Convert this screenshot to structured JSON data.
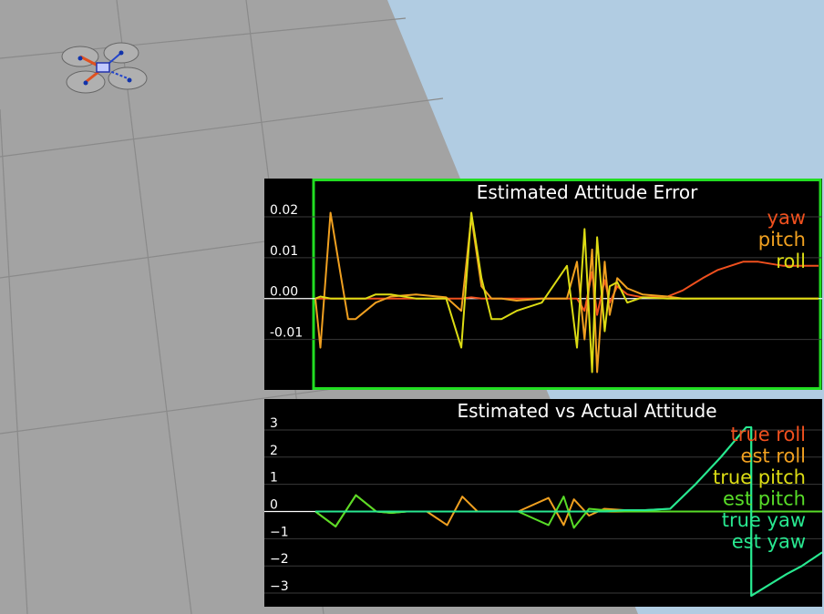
{
  "colors": {
    "sky": "#b1cce2",
    "ground": "#a3a3a3",
    "grid_line": "#8a8a8a",
    "panel_bg": "#000000",
    "active_border": "#22dd22",
    "zero_line": "#ffffff",
    "red": "#f0501e",
    "orange": "#f0a020",
    "yellow": "#dcdc14",
    "green": "#58dc28",
    "teal": "#28e890"
  },
  "quad": {
    "icon": "quadrotor-icon"
  },
  "charts": [
    {
      "title": "Estimated Attitude Error",
      "y_ticks": [
        "0.02",
        "0.01",
        "0.00",
        "-0.01"
      ],
      "y_tick_values": [
        0.02,
        0.01,
        0.0,
        -0.01
      ],
      "ylim": [
        -0.021,
        0.024
      ],
      "xlim": [
        0,
        10
      ],
      "legend": [
        {
          "label": "yaw",
          "color": "#f0501e"
        },
        {
          "label": "pitch",
          "color": "#f0a020"
        },
        {
          "label": "roll",
          "color": "#dcdc14"
        }
      ],
      "chart_data": {
        "type": "line",
        "x": [
          0,
          0.1,
          0.3,
          0.5,
          0.65,
          0.8,
          1.0,
          1.2,
          1.5,
          2.0,
          2.6,
          2.9,
          3.1,
          3.3,
          3.5,
          3.7,
          4.0,
          4.5,
          5.0,
          5.2,
          5.35,
          5.5,
          5.6,
          5.75,
          5.85,
          6.0,
          6.2,
          6.5,
          7.0,
          7.3,
          7.7,
          8.0,
          8.5,
          8.8,
          9.3,
          10
        ],
        "series": [
          {
            "name": "yaw",
            "values": [
              0,
              0,
              0,
              0,
              0,
              0,
              0,
              0,
              0,
              0,
              0,
              0,
              0.0003,
              0,
              0,
              0,
              0,
              0,
              0,
              0,
              -0.003,
              0.0065,
              -0.004,
              0.0045,
              -0.001,
              0.003,
              0.001,
              0.0003,
              0.0005,
              0.002,
              0.005,
              0.007,
              0.009,
              0.009,
              0.008,
              0.008
            ]
          },
          {
            "name": "pitch",
            "values": [
              0,
              -0.012,
              0.021,
              0.006,
              -0.005,
              -0.005,
              -0.003,
              -0.001,
              0.0005,
              0.001,
              0.0003,
              -0.003,
              0.02,
              0.003,
              0,
              0,
              -0.0005,
              0,
              0,
              0.009,
              -0.01,
              0.012,
              -0.018,
              0.009,
              -0.004,
              0.005,
              0.0025,
              0.001,
              0.0005,
              0,
              0,
              0,
              0,
              0,
              0,
              0
            ]
          },
          {
            "name": "roll",
            "values": [
              0,
              0.0005,
              0,
              0,
              0,
              0,
              0,
              0.001,
              0.001,
              0,
              0,
              -0.012,
              0.021,
              0.005,
              -0.005,
              -0.005,
              -0.003,
              -0.001,
              0.008,
              -0.012,
              0.017,
              -0.018,
              0.015,
              -0.008,
              0.003,
              0.004,
              -0.001,
              0.0003,
              0,
              0,
              0,
              0,
              0,
              0,
              0,
              0
            ]
          }
        ],
        "ylabel": "",
        "xlabel": "",
        "grid": true
      }
    },
    {
      "title": "Estimated vs Actual Attitude",
      "y_ticks": [
        "3",
        "2",
        "1",
        "0",
        "−1",
        "−2",
        "−3"
      ],
      "y_tick_values": [
        3,
        2,
        1,
        0,
        -1,
        -2,
        -3
      ],
      "ylim": [
        -3.3,
        3.4
      ],
      "xlim": [
        0,
        10
      ],
      "legend": [
        {
          "label": "true roll",
          "color": "#f0501e"
        },
        {
          "label": "est roll",
          "color": "#f0a020"
        },
        {
          "label": "true pitch",
          "color": "#dcdc14"
        },
        {
          "label": "est pitch",
          "color": "#58dc28"
        },
        {
          "label": "true yaw",
          "color": "#28e890"
        },
        {
          "label": "est yaw",
          "color": "#28e890"
        }
      ],
      "chart_data": {
        "type": "line",
        "x": [
          0,
          0.4,
          0.8,
          1.2,
          1.5,
          1.8,
          2.2,
          2.6,
          2.9,
          3.2,
          3.6,
          4.0,
          4.6,
          4.9,
          5.1,
          5.4,
          5.7,
          6.1,
          6.5,
          7.0,
          7.5,
          8.0,
          8.5,
          8.6,
          8.6,
          9.3,
          9.6,
          10
        ],
        "series": [
          {
            "name": "true roll",
            "values": [
              0,
              0,
              0,
              0,
              0,
              0,
              0,
              0,
              0,
              0,
              0,
              0,
              0,
              0,
              0,
              0,
              0,
              0,
              0,
              0,
              0,
              0,
              0,
              0,
              0,
              0,
              0,
              0
            ]
          },
          {
            "name": "est roll",
            "values": [
              0,
              0,
              0,
              0,
              0,
              0,
              0,
              -0.5,
              0.55,
              0,
              0,
              0,
              0.5,
              -0.5,
              0.45,
              -0.15,
              0.1,
              0.05,
              0,
              0,
              0,
              0,
              0,
              0,
              0,
              0,
              0,
              0
            ]
          },
          {
            "name": "true pitch",
            "values": [
              0,
              -0.55,
              0.6,
              0,
              -0.05,
              0,
              0,
              0,
              0,
              0,
              0,
              0,
              0,
              0,
              0,
              0,
              0,
              0,
              0,
              0,
              0,
              0,
              0,
              0,
              0,
              0,
              0,
              0
            ]
          },
          {
            "name": "est pitch",
            "values": [
              0,
              -0.55,
              0.6,
              0,
              -0.05,
              0,
              0,
              0,
              0,
              0,
              0,
              0,
              -0.5,
              0.55,
              -0.6,
              0.1,
              0.05,
              0,
              0,
              0,
              0,
              0,
              0,
              0,
              0,
              0,
              0,
              0
            ]
          },
          {
            "name": "true yaw",
            "values": [
              0,
              0,
              0,
              0,
              0,
              0,
              0,
              0,
              0,
              0,
              0,
              0,
              0,
              0,
              0,
              0,
              0,
              0.05,
              0.05,
              0.1,
              1.0,
              2.0,
              3.1,
              3.1,
              -3.1,
              -2.3,
              -2.0,
              -1.5
            ]
          },
          {
            "name": "est yaw",
            "values": [
              0,
              0,
              0,
              0,
              0,
              0,
              0,
              0,
              0,
              0,
              0,
              0,
              0,
              0,
              0,
              0,
              0,
              0.05,
              0.05,
              0.1,
              1.0,
              2.0,
              3.1,
              3.1,
              -3.1,
              -2.3,
              -2.0,
              -1.5
            ]
          }
        ],
        "ylabel": "",
        "xlabel": "",
        "grid": true
      }
    }
  ]
}
